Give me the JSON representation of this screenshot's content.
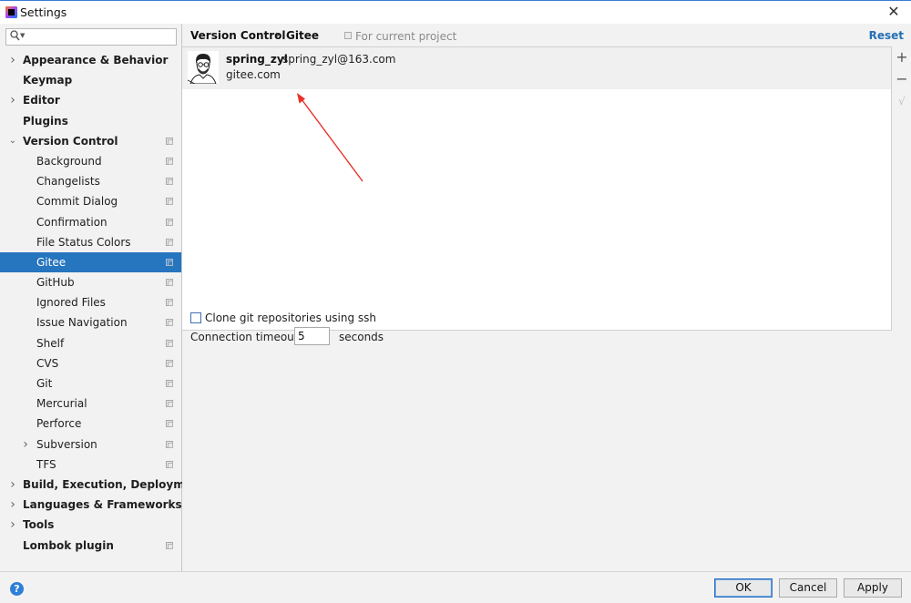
{
  "window": {
    "title": "Settings"
  },
  "search": {
    "placeholder": ""
  },
  "tree": [
    {
      "label": "Appearance & Behavior",
      "level": 0,
      "bold": true,
      "arrow": "right",
      "project": false,
      "selected": false
    },
    {
      "label": "Keymap",
      "level": 0,
      "bold": true,
      "arrow": "none",
      "project": false,
      "selected": false
    },
    {
      "label": "Editor",
      "level": 0,
      "bold": true,
      "arrow": "right",
      "project": false,
      "selected": false
    },
    {
      "label": "Plugins",
      "level": 0,
      "bold": true,
      "arrow": "none",
      "project": false,
      "selected": false
    },
    {
      "label": "Version Control",
      "level": 0,
      "bold": true,
      "arrow": "down",
      "project": true,
      "selected": false
    },
    {
      "label": "Background",
      "level": 1,
      "bold": false,
      "arrow": "none",
      "project": true,
      "selected": false
    },
    {
      "label": "Changelists",
      "level": 1,
      "bold": false,
      "arrow": "none",
      "project": true,
      "selected": false
    },
    {
      "label": "Commit Dialog",
      "level": 1,
      "bold": false,
      "arrow": "none",
      "project": true,
      "selected": false
    },
    {
      "label": "Confirmation",
      "level": 1,
      "bold": false,
      "arrow": "none",
      "project": true,
      "selected": false
    },
    {
      "label": "File Status Colors",
      "level": 1,
      "bold": false,
      "arrow": "none",
      "project": true,
      "selected": false
    },
    {
      "label": "Gitee",
      "level": 1,
      "bold": false,
      "arrow": "none",
      "project": true,
      "selected": true
    },
    {
      "label": "GitHub",
      "level": 1,
      "bold": false,
      "arrow": "none",
      "project": true,
      "selected": false
    },
    {
      "label": "Ignored Files",
      "level": 1,
      "bold": false,
      "arrow": "none",
      "project": true,
      "selected": false
    },
    {
      "label": "Issue Navigation",
      "level": 1,
      "bold": false,
      "arrow": "none",
      "project": true,
      "selected": false
    },
    {
      "label": "Shelf",
      "level": 1,
      "bold": false,
      "arrow": "none",
      "project": true,
      "selected": false
    },
    {
      "label": "CVS",
      "level": 1,
      "bold": false,
      "arrow": "none",
      "project": true,
      "selected": false
    },
    {
      "label": "Git",
      "level": 1,
      "bold": false,
      "arrow": "none",
      "project": true,
      "selected": false
    },
    {
      "label": "Mercurial",
      "level": 1,
      "bold": false,
      "arrow": "none",
      "project": true,
      "selected": false
    },
    {
      "label": "Perforce",
      "level": 1,
      "bold": false,
      "arrow": "none",
      "project": true,
      "selected": false
    },
    {
      "label": "Subversion",
      "level": 1,
      "bold": false,
      "arrow": "right",
      "project": true,
      "selected": false
    },
    {
      "label": "TFS",
      "level": 1,
      "bold": false,
      "arrow": "none",
      "project": true,
      "selected": false
    },
    {
      "label": "Build, Execution, Deployment",
      "level": 0,
      "bold": true,
      "arrow": "right",
      "project": false,
      "selected": false
    },
    {
      "label": "Languages & Frameworks",
      "level": 0,
      "bold": true,
      "arrow": "right",
      "project": false,
      "selected": false
    },
    {
      "label": "Tools",
      "level": 0,
      "bold": true,
      "arrow": "right",
      "project": false,
      "selected": false
    },
    {
      "label": "Lombok plugin",
      "level": 0,
      "bold": true,
      "arrow": "none",
      "project": true,
      "selected": false
    }
  ],
  "breadcrumb": {
    "parent": "Version Control",
    "separator": "›",
    "current": "Gitee"
  },
  "scope_label": "For current project",
  "reset_label": "Reset",
  "account": {
    "username": "spring_zyl",
    "email": "spring_zyl@163.com",
    "server": "gitee.com"
  },
  "toolbar": {
    "add": "+",
    "remove": "−",
    "default": "√"
  },
  "options": {
    "clone_ssh_label": "Clone git repositories using ssh",
    "clone_ssh_checked": false,
    "timeout_label": "Connection timeout:",
    "timeout_value": "5",
    "timeout_unit": "seconds"
  },
  "footer": {
    "help": "?",
    "ok": "OK",
    "cancel": "Cancel",
    "apply": "Apply"
  },
  "colors": {
    "selection": "#2675bf",
    "link": "#2470b3",
    "annotation_arrow": "#e8322b",
    "help_icon": "#2d7fd7"
  }
}
